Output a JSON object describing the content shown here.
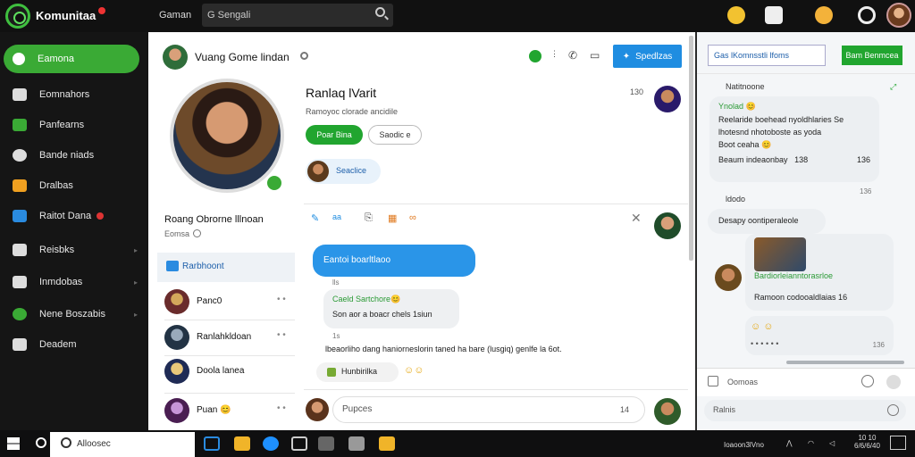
{
  "app": {
    "brand": "Komunitaa"
  },
  "topbar": {
    "nav_item": "Gaman",
    "search_text": "G Sengali"
  },
  "sidebar": {
    "items": [
      {
        "label": "Eamona",
        "active": true
      },
      {
        "label": "Eomnahors"
      },
      {
        "label": "Panfearns"
      },
      {
        "label": "Bande niads"
      },
      {
        "label": "Dralbas"
      },
      {
        "label": "Raitot Dana",
        "badge": true
      },
      {
        "label": "Reisbks"
      },
      {
        "label": "Inmdobas"
      },
      {
        "label": "Nene Boszabis"
      },
      {
        "label": "Deadem"
      }
    ]
  },
  "chat_header": {
    "title": "Vuang Gome lindan",
    "action_button": "Spedlzas"
  },
  "profile": {
    "display_name": "Roang Obrorne lllnoan",
    "status": "Eomsa",
    "friends_heading": "Rarbhoont",
    "friends": [
      {
        "name": "Panc0"
      },
      {
        "name": "Ranlahkldoan"
      },
      {
        "name": "Doola lanea"
      },
      {
        "name": "Puan 😊"
      }
    ]
  },
  "post": {
    "title": "Ranlaq lVarit",
    "subtitle": "Ramoyoc clorade ancidile",
    "primary_button": "Poar Bina",
    "secondary_button": "Saodic e",
    "count": "130",
    "chip_label": "Seaclice"
  },
  "messages": {
    "blue_bubble": "Eantoi boarltlaoo",
    "blue_meta": "lls",
    "grey_line1": "Caeld Sartchore😊",
    "grey_line2": "Son aor a boacr chels 1siun",
    "grey_meta": "1s",
    "long_text": "lbeaorliho dang haniorneslorin taned ha bare (lusgiq) genlfe la 6ot.",
    "reaction_label": "Hunbirilka",
    "composer_placeholder": "Pupces",
    "composer_count": "14"
  },
  "right_panel": {
    "search_text": "Gas lKomnsstli lfoms",
    "button_label": "Bam Benmcea",
    "section1_label": "Natitnoone",
    "card1": {
      "line1": "Ynolad 😊",
      "line2": "Reelaride boehead nyoldhlaries Se",
      "line3": "lhotesnd nhotoboste as yoda",
      "line4": "Boot ceaha 😊",
      "footer": "Beaum indeaonbay",
      "footer_num": "138",
      "footer_right": "136",
      "footer_right2": "136"
    },
    "section2_label": "ldodo",
    "card2_text": "Desapy oontiperaleole",
    "card3_line1": "Bardiorleianntorasrloe",
    "card3_line2": "Ramoon codooaldlaias 16",
    "card4_meta": "136",
    "comment_placeholder": "Oomoas",
    "reply_placeholder": "Ralnis"
  },
  "taskbar": {
    "search_placeholder": "Alloosec",
    "tray_text": "Ioaoon3lVno",
    "clock_time": "10 10",
    "clock_date": "6/6/6/40"
  }
}
